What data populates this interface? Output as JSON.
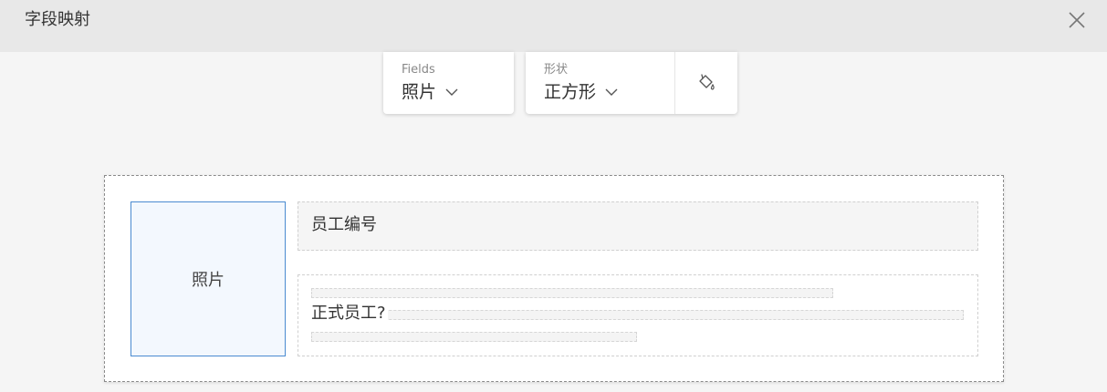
{
  "dialog": {
    "title": "字段映射",
    "close_icon": "close-icon"
  },
  "toolbar": {
    "fields": {
      "label": "Fields",
      "value": "照片",
      "icon": "chevron-down-icon"
    },
    "shape": {
      "label": "形状",
      "value": "正方形",
      "icon": "chevron-down-icon"
    },
    "fill_icon": "paint-bucket-icon"
  },
  "preview": {
    "photo_label": "照片",
    "fields": [
      {
        "label": "员工编号"
      },
      {
        "label": "正式员工?"
      }
    ]
  },
  "colors": {
    "header_bg": "#e8e8e8",
    "page_bg": "#f5f5f5",
    "accent_border": "#4a8bd0",
    "photo_bg": "#f3f8fe"
  }
}
